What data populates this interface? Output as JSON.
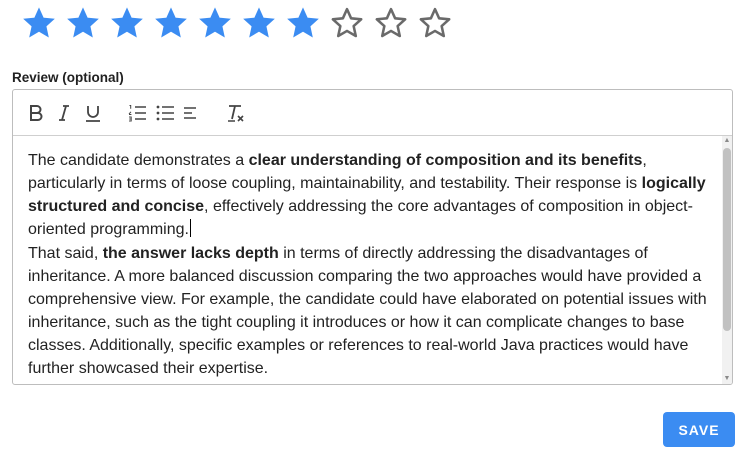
{
  "rating": {
    "value": 7,
    "max": 10,
    "filled_color": "#3b8cf2",
    "empty_color": "#6a6a6a",
    "icon": "star-icon"
  },
  "review": {
    "label": "Review (optional)",
    "toolbar": {
      "bold_icon": "bold-icon",
      "italic_icon": "italic-icon",
      "underline_icon": "underline-icon",
      "ordered_list_icon": "ordered-list-icon",
      "bullet_list_icon": "bullet-list-icon",
      "align_icon": "align-left-icon",
      "clear_format_icon": "clear-formatting-icon"
    },
    "paragraphs": [
      [
        {
          "text": "The candidate demonstrates a "
        },
        {
          "text": "clear understanding of composition and its benefits",
          "bold": true
        },
        {
          "text": ", particularly in terms of loose coupling, maintainability, and testability. Their response is "
        },
        {
          "text": "logically structured and concise",
          "bold": true
        },
        {
          "text": ", effectively addressing the core advantages of composition in object-oriented programming."
        }
      ],
      [
        {
          "text": "That said, "
        },
        {
          "text": "the answer lacks depth",
          "bold": true
        },
        {
          "text": " in terms of directly addressing the disadvantages of inheritance. A more balanced discussion comparing the two approaches would have provided a comprehensive view. For example, the candidate could have elaborated on potential issues with inheritance, such as the tight coupling it introduces or how it can complicate changes to base classes. Additionally, specific examples or references to real-world Java practices would have further showcased their expertise."
        }
      ]
    ]
  },
  "actions": {
    "save_label": "SAVE",
    "accent": "#3b8cf2"
  }
}
